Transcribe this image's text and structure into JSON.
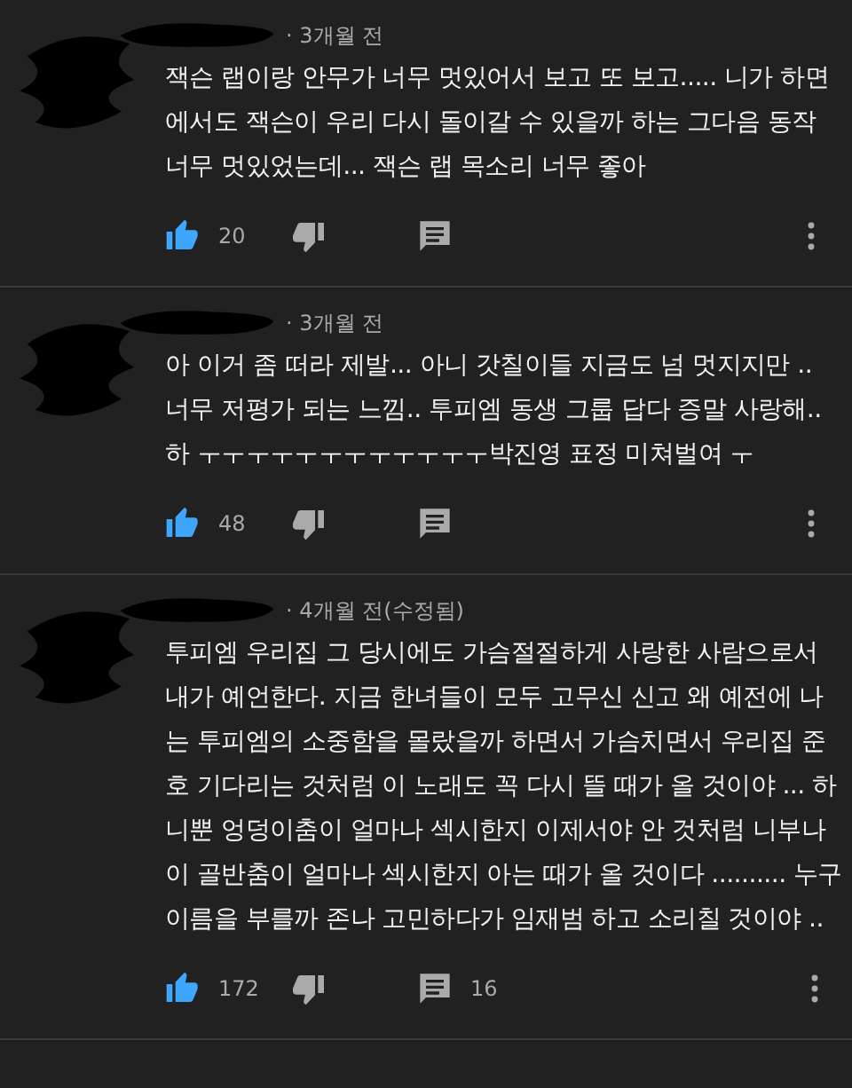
{
  "comments": [
    {
      "meta": "· 3개월 전",
      "text": "잭슨 랩이랑 안무가 너무 멋있어서 보고 또 보고..... 니가 하면\n에서도 잭슨이 우리 다시 돌이갈 수 있을까 하는 그다음 동작\n너무 멋있었는데... 잭슨 랩 목소리 너무 좋아",
      "liked": true,
      "likes": "20"
    },
    {
      "meta": "· 3개월 전",
      "text": "아 이거 좀 떠라 제발... 아니 갓칠이들 지금도 넘 멋지지만 ..\n너무 저평가 되는 느낌.. 투피엠 동생 그룹 답다 증말 사랑해..\n하 ㅜㅜㅜㅜㅜㅜㅜㅜㅜㅜㅜㅜ박진영 표정 미쳐벌여 ㅜ",
      "liked": true,
      "likes": "48"
    },
    {
      "meta": "· 4개월 전(수정됨)",
      "text": "투피엠 우리집 그 당시에도 가슴절절하게 사랑한 사람으로서\n내가 예언한다. 지금 한녀들이 모두 고무신 신고 왜 예전에 나\n는 투피엠의 소중함을 몰랐을까 하면서 가슴치면서 우리집 준\n호 기다리는 것처럼 이 노래도 꼭 다시 뜰 때가 올 것이야 ... 하\n니뿐 엉덩이춤이 얼마나 섹시한지 이제서야 안 것처럼 니부나\n이 골반춤이 얼마나 섹시한지 아는 때가 올 것이다 .......... 누구\n이름을 부를까 존나 고민하다가 임재범 하고 소리칠 것이야 ..",
      "liked": true,
      "likes": "172",
      "replies": "16"
    }
  ]
}
